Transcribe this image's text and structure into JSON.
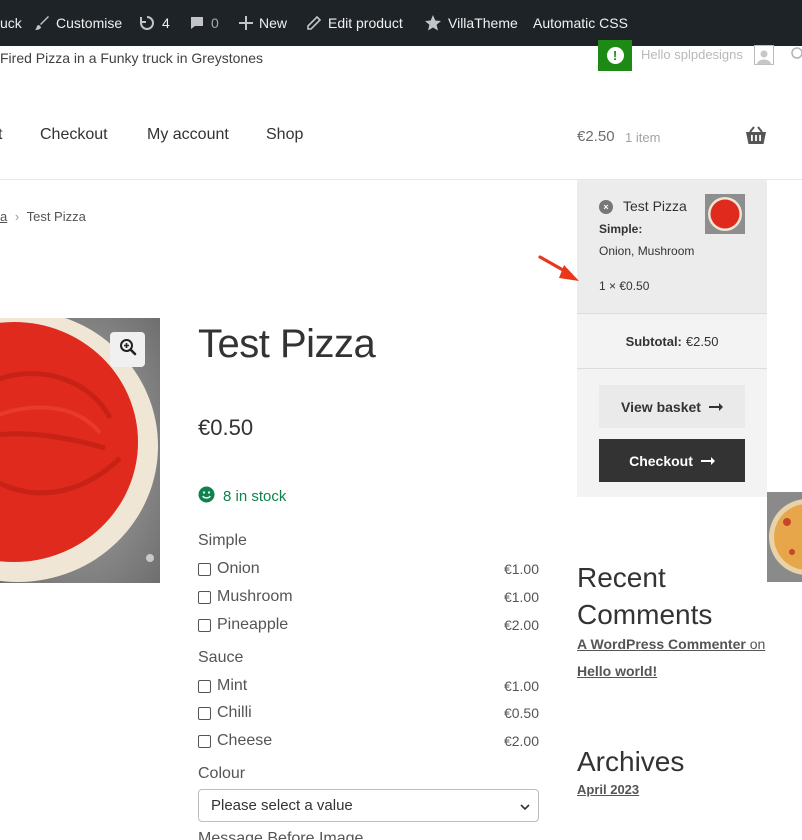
{
  "adminbar": {
    "items": [
      {
        "label": "uck"
      },
      {
        "label": "Customise"
      },
      {
        "label": "4"
      },
      {
        "label": "0"
      },
      {
        "label": "New"
      },
      {
        "label": "Edit product"
      },
      {
        "label": "VillaTheme"
      },
      {
        "label": "Automatic CSS"
      }
    ]
  },
  "header": {
    "tagline": "Fired Pizza in a Funky truck in Greystones",
    "greeting": "Hello splpdesigns"
  },
  "nav": {
    "items": [
      {
        "label": "t"
      },
      {
        "label": "Checkout"
      },
      {
        "label": "My account"
      },
      {
        "label": "Shop"
      }
    ],
    "cart_total": "€2.50",
    "cart_count": "1 item"
  },
  "breadcrumb": {
    "parent": "a",
    "separator": "›",
    "current": "Test Pizza"
  },
  "product": {
    "title": "Test Pizza",
    "price": "€0.50",
    "stock": "8 in stock",
    "groups": [
      {
        "title": "Simple",
        "options": [
          {
            "name": "Onion",
            "price": "€1.00"
          },
          {
            "name": "Mushroom",
            "price": "€1.00"
          },
          {
            "name": "Pineapple",
            "price": "€2.00"
          }
        ]
      },
      {
        "title": "Sauce",
        "options": [
          {
            "name": "Mint",
            "price": "€1.00"
          },
          {
            "name": "Chilli",
            "price": "€0.50"
          },
          {
            "name": "Cheese",
            "price": "€2.00"
          }
        ]
      }
    ],
    "colour_label": "Colour",
    "colour_select": "Please select a value",
    "next_label": "Message Before Image"
  },
  "minicart": {
    "remove_symbol": "×",
    "item_name": "Test Pizza",
    "attr_label": "Simple:",
    "attr_value": "Onion, Mushroom",
    "quantity": "1 × €0.50",
    "subtotal_label": "Subtotal:",
    "subtotal_value": "€2.50",
    "view_basket": "View basket",
    "checkout": "Checkout"
  },
  "sidebar": {
    "recent_comments_title": "Recent Comments",
    "comment_author": "A WordPress Commenter",
    "comment_on": "on",
    "comment_post": "Hello world!",
    "archives_title": "Archives",
    "archive_month": "April 2023"
  },
  "colors": {
    "adminbar_bg": "#1d2327",
    "stock_green": "#0f834d",
    "alert_green": "#1e8a16",
    "checkout_dark": "#333333",
    "annotation_red": "#e8381b"
  }
}
